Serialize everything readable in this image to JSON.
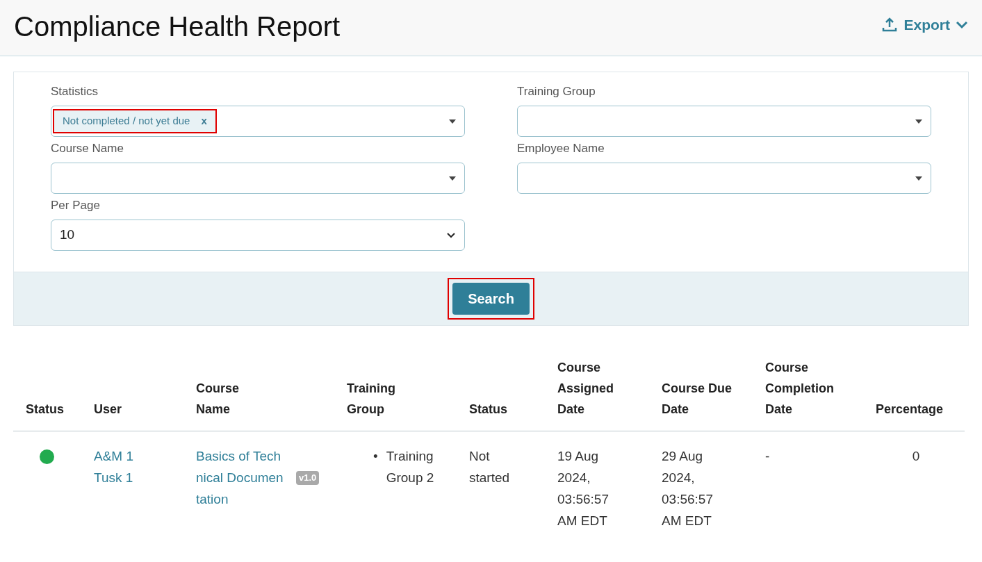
{
  "page": {
    "title": "Compliance Health Report",
    "export_label": "Export"
  },
  "filters": [
    {
      "label": "Statistics",
      "kind": "multiselect",
      "tags": [
        {
          "text": "Not completed / not yet due",
          "remove": "x",
          "highlighted": true
        }
      ]
    },
    {
      "label": "Training Group",
      "kind": "multiselect"
    },
    {
      "label": "Course Name",
      "kind": "multiselect"
    },
    {
      "label": "Employee Name",
      "kind": "multiselect"
    },
    {
      "label": "Per Page",
      "kind": "select",
      "value": "10"
    }
  ],
  "search_button": {
    "label": "Search",
    "highlighted": true
  },
  "table": {
    "columns": [
      "Status",
      "User",
      "Course Name",
      "Training Group",
      "Status",
      "Course Assigned Date",
      "Course Due Date",
      "Course Completion Date",
      "Percentage"
    ],
    "rows": [
      {
        "color": "#22ab4f",
        "user": "A&M 1 Tusk 1",
        "course": "Basics of Technical Documentation",
        "version": "v1.0",
        "groups": [
          {
            "bullet": "•",
            "text": "Training Group 2"
          }
        ],
        "status": "Not started",
        "assigned": "19 Aug 2024, 03:56:57 AM EDT",
        "due": "29 Aug 2024, 03:56:57 AM EDT",
        "completed": "-",
        "percentage": "0"
      }
    ]
  }
}
